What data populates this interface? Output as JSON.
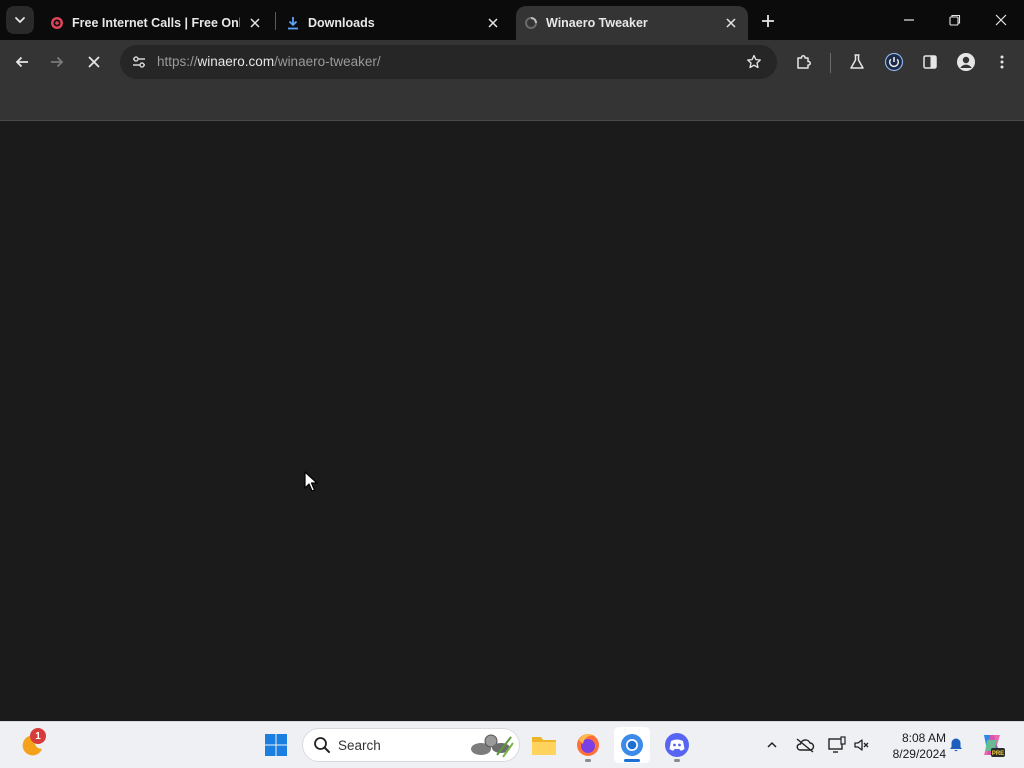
{
  "browser": {
    "tabs": [
      {
        "title": "Free Internet Calls | Free Online",
        "icon": "poptox-favicon",
        "active": false
      },
      {
        "title": "Downloads",
        "icon": "download-icon",
        "active": false
      },
      {
        "title": "Winaero Tweaker",
        "icon": "loading-spinner-icon",
        "active": true
      }
    ],
    "url": {
      "scheme": "https://",
      "host": "winaero.com",
      "path": "/winaero-tweaker/"
    }
  },
  "taskbar": {
    "search_placeholder": "Search",
    "notification_badge": "1",
    "clock_time": "8:08 AM",
    "clock_date": "8/29/2024",
    "copilot_label": "PRE"
  },
  "colors": {
    "tab_strip": "#0b0b0b",
    "toolbar": "#343434",
    "page_bg": "#1b1b1b",
    "taskbar": "#eef0f4",
    "accent": "#1d6fd1"
  }
}
